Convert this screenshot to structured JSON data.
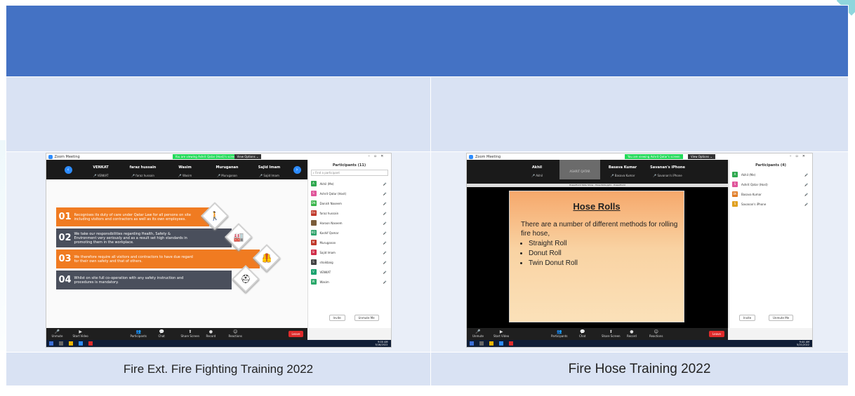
{
  "colors": {
    "header": "#4472c4",
    "row_light": "#d9e2f3",
    "zoom_blue": "#2d8cff",
    "banner_green": "#23d959",
    "mic_red": "#e02b2b",
    "orange": "#f07b21",
    "slate": "#4a4f5c"
  },
  "left": {
    "caption": "Fire Ext. Fire Fighting Training 2022",
    "zoom": {
      "title": "Zoom Meeting",
      "banner": "You are viewing Ashrit Qatar (Host)'s screen",
      "view_options": "View Options ⌄",
      "view_btn": "View",
      "tiles": [
        {
          "name": "VENKAT",
          "sub": "VENKAT"
        },
        {
          "name": "faraz hussain",
          "sub": "faraz hussain"
        },
        {
          "name": "Wasim",
          "sub": "Wasim"
        },
        {
          "name": "Muruganan",
          "sub": "Muruganan"
        },
        {
          "name": "Sajid Imam",
          "sub": "Sajid Imam"
        }
      ],
      "panel_title": "Participants (11)",
      "find_placeholder": "Find a participant",
      "participants": [
        {
          "initials": "A",
          "name": "Akhil (Me)",
          "color": "#2fa84f"
        },
        {
          "initials": "S",
          "name": "Ashrit Qatar (Host)",
          "color": "#e0559a"
        },
        {
          "initials": "DN",
          "name": "Danish Naseem",
          "color": "#39b54a"
        },
        {
          "initials": "FH",
          "name": "faraz hussain",
          "color": "#c0392b"
        },
        {
          "initials": "",
          "name": "Haroon Naseem",
          "color": "#7a5c3a"
        },
        {
          "initials": "KQ",
          "name": "Kashif Qamar",
          "color": "#2ea36a"
        },
        {
          "initials": "M",
          "name": "Muruganan",
          "color": "#c0392b"
        },
        {
          "initials": "SI",
          "name": "Sajid Imam",
          "color": "#d12f4a"
        },
        {
          "initials": "S",
          "name": "shaikbaig",
          "color": "#444"
        },
        {
          "initials": "V",
          "name": "VENKAT",
          "color": "#1aa36f"
        },
        {
          "initials": "W",
          "name": "Wasim",
          "color": "#2aa86a"
        }
      ],
      "invite": "Invite",
      "unmute": "Unmute Me",
      "toolbar": [
        "Unmute",
        "Start Video",
        "Participants",
        "Chat",
        "Share Screen",
        "Record",
        "Reactions"
      ],
      "leave": "Leave",
      "clock": "9:00 AM\n5/16/2022"
    },
    "slide": {
      "items": [
        {
          "num": "01",
          "text": "Recognises its duty of care under Qatar Law for all persons on site including visitors and contractors as well as its own employees.",
          "icon": "🚶"
        },
        {
          "num": "02",
          "text": "We take our responsibilities regarding Health, Safety & Environment very seriously and as a result set high standards in promoting them in the workplace.",
          "icon": "🏭"
        },
        {
          "num": "03",
          "text": "We therefore require all visitors and contractors to have due regard for their own safety and that of others.",
          "icon": "🦺"
        },
        {
          "num": "04",
          "text": "Whilst on site full co-operation with any safety instruction and procedures is mandatory.",
          "icon": "⛑"
        }
      ]
    }
  },
  "right": {
    "caption": "Fire Hose Training 2022",
    "zoom": {
      "title": "Zoom Meeting",
      "banner": "You are viewing Ashrit Qatar's screen",
      "view_options": "View Options ⌄",
      "view_btn": "View",
      "tiles": [
        {
          "name": "Akhil",
          "sub": "Akhil"
        },
        {
          "name": "",
          "sub": "ASHRIT QATAR"
        },
        {
          "name": "Basava Kumar",
          "sub": "Basava Kumar"
        },
        {
          "name": "Savanan's iPhone",
          "sub": "Savanan's iPhone"
        }
      ],
      "ppt_title": "PowerPoint Slide Show - Hose Rolls.pptx - PowerPoint",
      "panel_title": "Participants (4)",
      "participants": [
        {
          "initials": "A",
          "name": "Akhil (Me)",
          "color": "#2fa84f"
        },
        {
          "initials": "S",
          "name": "Ashrit Qatar (Host)",
          "color": "#e0559a"
        },
        {
          "initials": "BK",
          "name": "Basava Kumar",
          "color": "#e07b24"
        },
        {
          "initials": "S",
          "name": "Savanan's iPhone",
          "color": "#e0a020"
        }
      ],
      "invite": "Invite",
      "unmute": "Unmute Me",
      "toolbar": [
        "Unmute",
        "Start Video",
        "Participants",
        "Chat",
        "Share Screen",
        "Record",
        "Reactions"
      ],
      "leave": "Leave",
      "clock": "9:44 AM\n5/21/2022"
    },
    "slide": {
      "title": "Hose Rolls",
      "body": "There are a number of different methods for rolling fire hose,",
      "bullets": [
        "Straight Roll",
        "Donut Roll",
        "Twin Donut Roll"
      ]
    }
  }
}
